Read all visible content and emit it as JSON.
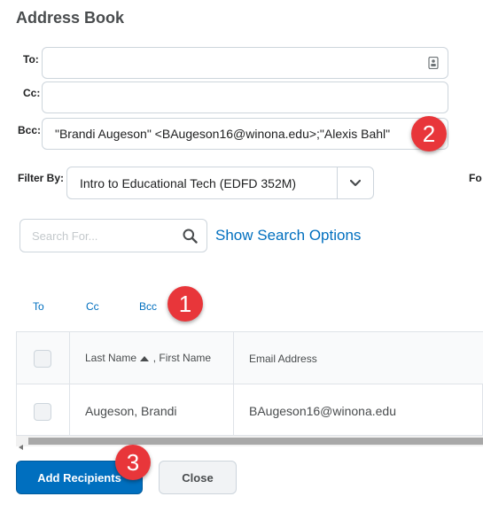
{
  "dialog": {
    "title": "Address Book"
  },
  "fields": {
    "to": {
      "label": "To:",
      "value": ""
    },
    "cc": {
      "label": "Cc:",
      "value": ""
    },
    "bcc": {
      "label": "Bcc:",
      "value": "\"Brandi Augeson\" <BAugeson16@winona.edu>;\"Alexis Bahl\""
    }
  },
  "filter": {
    "label": "Filter By:",
    "selected": "Intro to Educational Tech (EDFD 352M)",
    "cut_label": "Fo"
  },
  "search": {
    "placeholder": "Search For...",
    "options_link": "Show Search Options"
  },
  "tabs": [
    {
      "label": "To"
    },
    {
      "label": "Cc"
    },
    {
      "label": "Bcc"
    }
  ],
  "table": {
    "columns": {
      "name": "Last Name",
      "name_suffix": ", First Name",
      "email": "Email Address"
    },
    "rows": [
      {
        "name": "Augeson, Brandi",
        "email": "BAugeson16@winona.edu"
      }
    ]
  },
  "buttons": {
    "add": "Add Recipients",
    "close": "Close"
  },
  "callouts": [
    "1",
    "2",
    "3"
  ],
  "colors": {
    "link": "#006fbf",
    "primary": "#006fbf",
    "callout": "#e8363a"
  }
}
